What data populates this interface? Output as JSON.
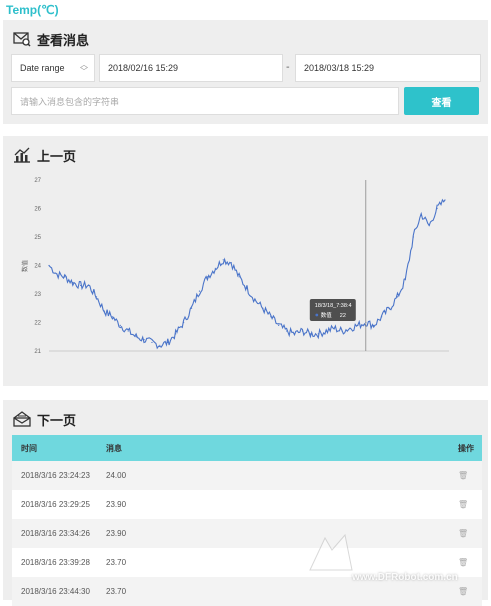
{
  "page_title": "Temp(℃)",
  "search": {
    "title": "查看消息",
    "range_label": "Date range",
    "start_date": "2018/02/16 15:29",
    "separator": "-",
    "end_date": "2018/03/18 15:29",
    "placeholder": "请输入消息包含的字符串",
    "button": "查看"
  },
  "chart": {
    "title": "上一页",
    "tooltip_time": "18/3/18_7:38:4",
    "tooltip_label": "数值",
    "tooltip_value": "22",
    "ylabel": "数值"
  },
  "chart_data": {
    "type": "line",
    "ylabel": "数值",
    "ylim": [
      21,
      27
    ],
    "yticks": [
      21,
      22,
      23,
      24,
      25,
      26,
      27
    ],
    "grid": false,
    "series": [
      {
        "x": [
          0,
          2,
          4,
          6,
          8,
          10,
          12,
          14,
          16,
          18,
          20,
          22,
          24,
          26,
          28,
          30,
          32,
          34,
          36,
          38,
          40,
          42,
          44,
          46,
          48,
          50,
          52,
          54,
          56,
          58,
          60,
          62,
          64,
          66,
          68,
          70,
          72,
          74,
          76,
          78,
          80,
          82,
          84,
          86,
          88,
          90,
          92,
          94,
          96,
          98,
          100
        ],
        "values": [
          24.0,
          23.7,
          23.6,
          23.4,
          23.3,
          23.3,
          22.9,
          22.4,
          22.2,
          21.9,
          21.7,
          21.5,
          21.4,
          21.3,
          21.2,
          21.3,
          21.6,
          22.0,
          22.5,
          23.1,
          23.6,
          23.9,
          24.2,
          24.1,
          23.6,
          23.2,
          22.8,
          22.5,
          22.2,
          21.9,
          21.7,
          21.6,
          21.7,
          21.6,
          21.6,
          21.7,
          21.8,
          21.7,
          21.8,
          21.9,
          22.0,
          21.9,
          22.2,
          22.5,
          22.9,
          23.5,
          25.0,
          25.8,
          25.4,
          26.0,
          26.3
        ]
      }
    ],
    "tooltip": {
      "time": "18/3/18_7:38:4",
      "label": "数值",
      "value": 22
    }
  },
  "table": {
    "title": "下一页",
    "columns": [
      "时间",
      "消息",
      "操作"
    ],
    "rows": [
      {
        "time": "2018/3/16 23:24:23",
        "message": "24.00"
      },
      {
        "time": "2018/3/16 23:29:25",
        "message": "23.90"
      },
      {
        "time": "2018/3/16 23:34:26",
        "message": "23.90"
      },
      {
        "time": "2018/3/16 23:39:28",
        "message": "23.70"
      },
      {
        "time": "2018/3/16 23:44:30",
        "message": "23.70"
      }
    ]
  },
  "watermark": "www.DFRobot.com.cn",
  "colors": {
    "accent": "#2ec2cb",
    "line": "#4a74c9",
    "table_header": "#6fd8de"
  }
}
